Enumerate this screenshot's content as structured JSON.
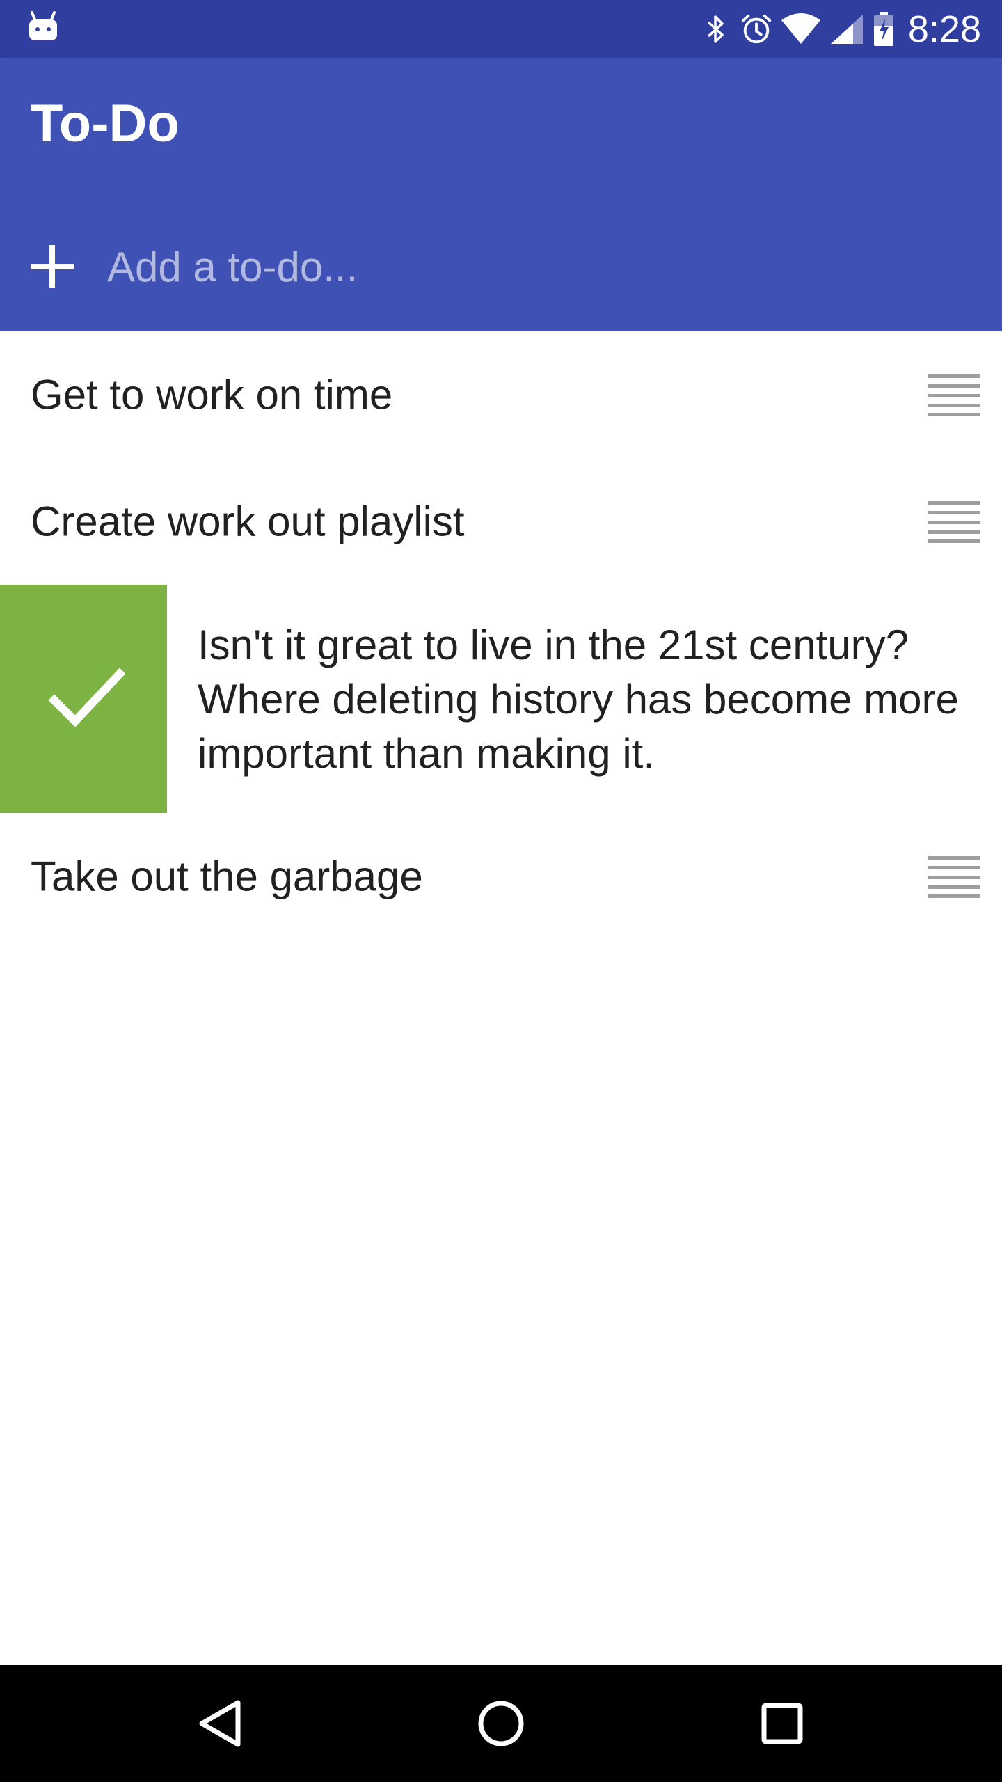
{
  "status_bar": {
    "time": "8:28",
    "icons": [
      "android-icon",
      "bluetooth-icon",
      "alarm-icon",
      "wifi-icon",
      "signal-icon",
      "battery-icon"
    ]
  },
  "app_bar": {
    "title": "To-Do",
    "add_placeholder": "Add a to-do...",
    "color": "#3f51b5",
    "status_color": "#303f9f"
  },
  "todos": {
    "items": [
      {
        "text": "Get to work on time"
      },
      {
        "text": "Create work out playlist"
      },
      {
        "text": "Isn't it great to live in the 21st century? Where deleting history has become more important than making it.",
        "state": "swiping-done"
      },
      {
        "text": "Take out the garbage"
      }
    ],
    "done_color": "#7cb342"
  },
  "nav_bar": {
    "buttons": [
      "back-icon",
      "home-icon",
      "recents-icon"
    ]
  }
}
